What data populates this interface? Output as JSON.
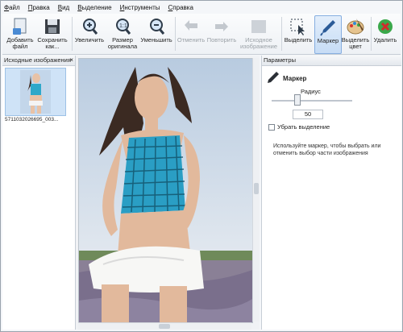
{
  "menu": [
    "Файл",
    "Правка",
    "Вид",
    "Выделение",
    "Инструменты",
    "Справка"
  ],
  "toolbar": {
    "add_file": "Добавить\nфайл",
    "save_as": "Сохранить\nкак...",
    "zoom_in": "Увеличить",
    "original_size": "Размер\nоригинала",
    "zoom_out": "Уменьшить",
    "undo": "Отменить",
    "redo": "Повторить",
    "source_image": "Исходное\nизображение",
    "select": "Выделить",
    "marker": "Маркер",
    "select_color": "Выделить\nцвет",
    "delete": "Удалить"
  },
  "left_panel": {
    "title": "Исходные изображения",
    "close": "×",
    "thumbnail_caption": "5711032026695_003..."
  },
  "right_panel": {
    "title": "Параметры",
    "tool_name": "Маркер",
    "radius_label": "Радиус",
    "radius_value": "50",
    "radius_fraction": 0.32,
    "remove_selection_label": "Убрать выделение",
    "hint": "Используйте маркер, чтобы выбрать или отменить выбор части изображения"
  }
}
